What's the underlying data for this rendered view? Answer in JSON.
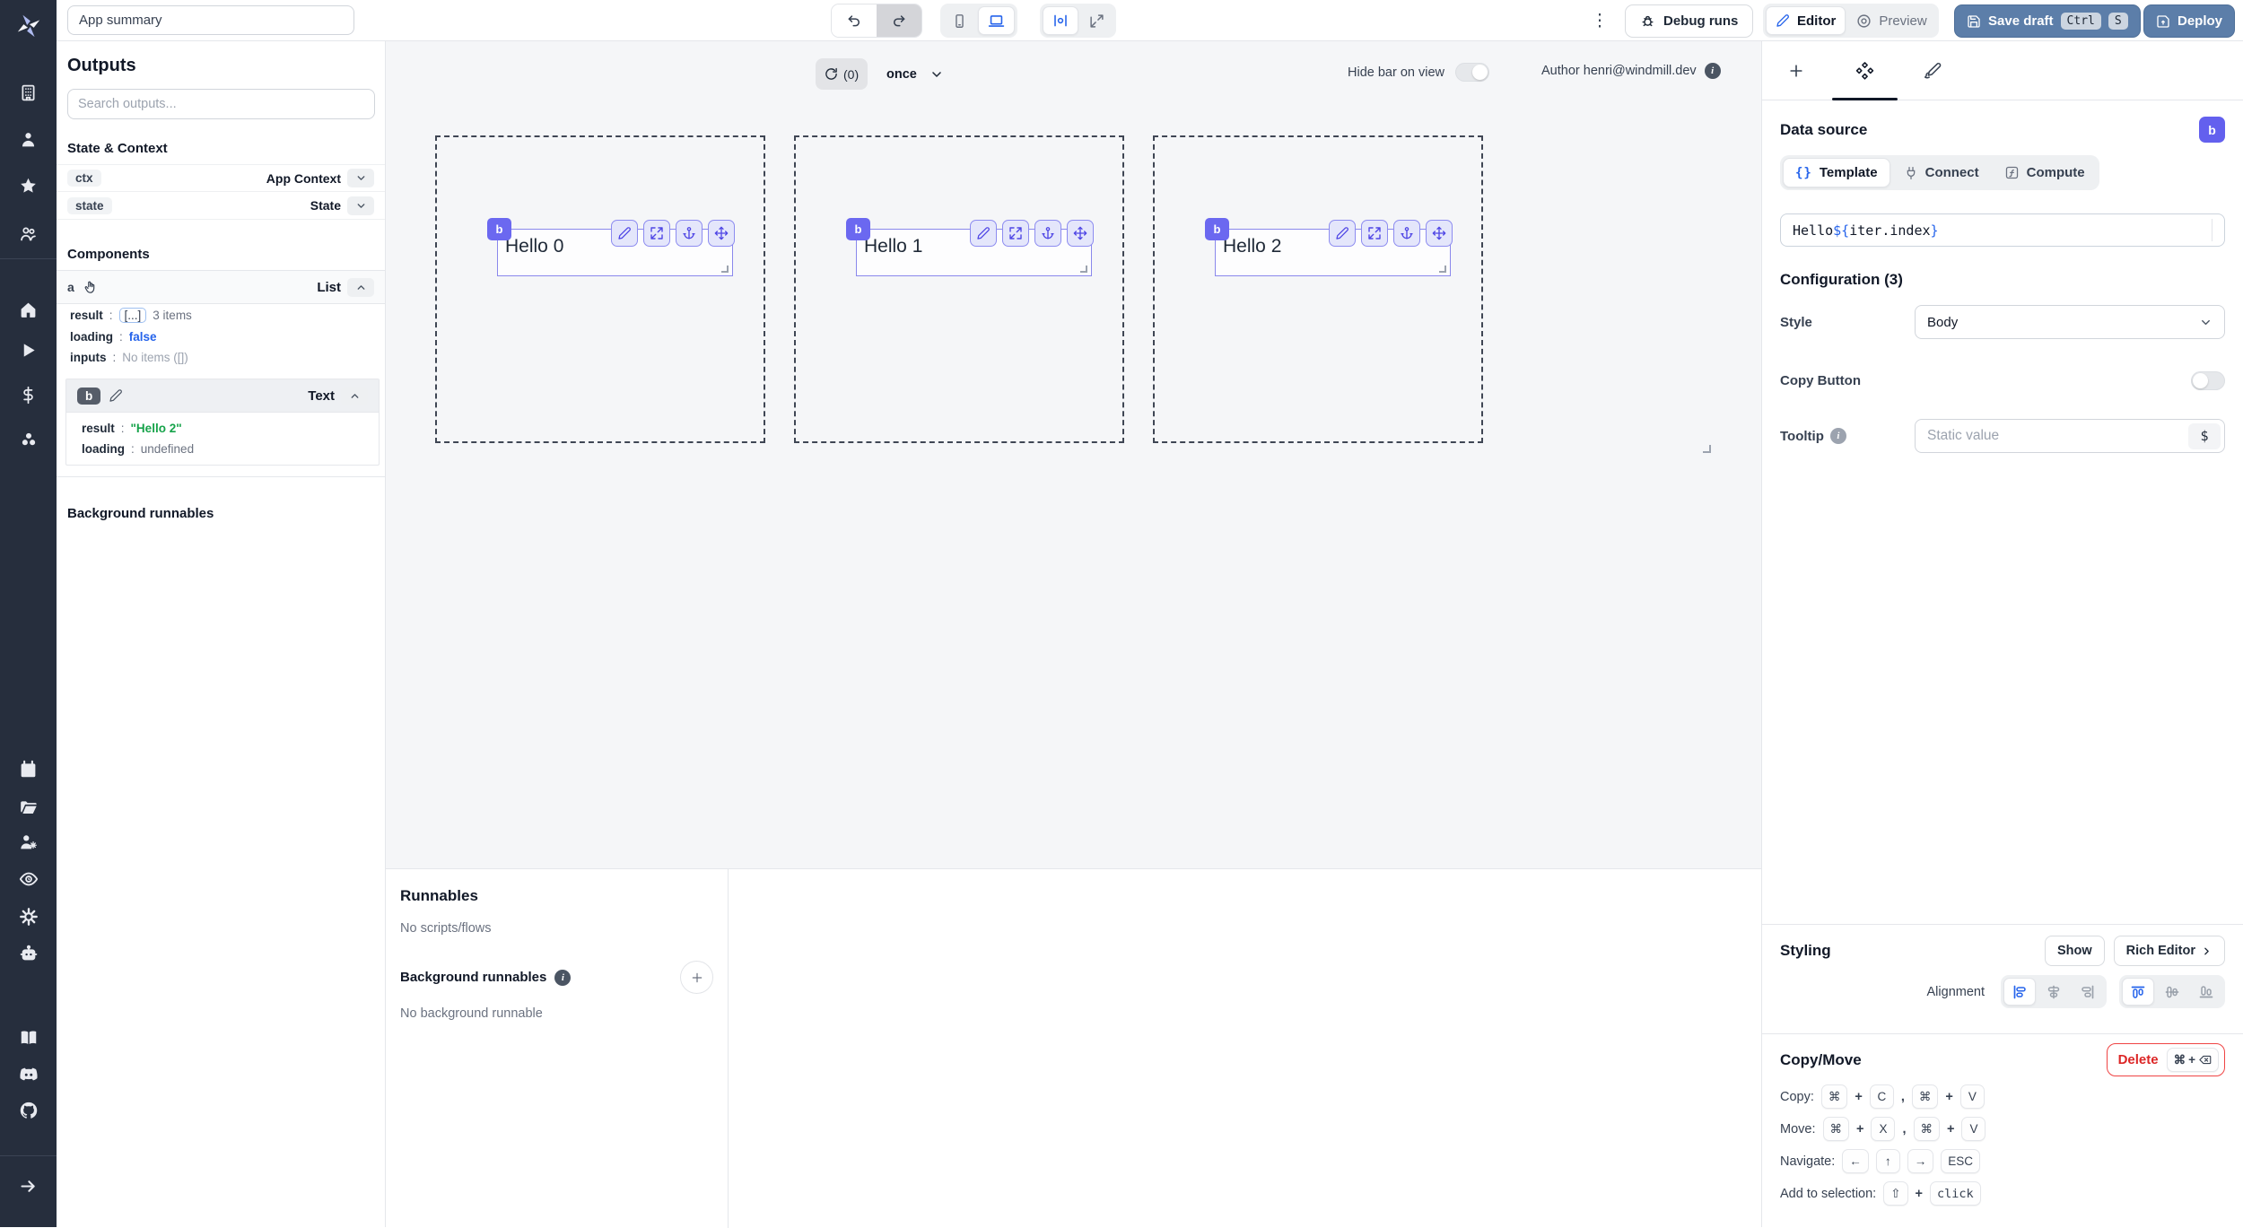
{
  "topbar": {
    "app_summary": "App summary",
    "menu_dots": "⋮",
    "debug_runs": "Debug runs",
    "editor": "Editor",
    "preview": "Preview",
    "save_draft": "Save draft",
    "save_kbd": [
      "Ctrl",
      "S"
    ],
    "deploy": "Deploy"
  },
  "iconbar_items": [
    "windmill-logo",
    "building",
    "user",
    "star",
    "users",
    "home",
    "play",
    "dollar",
    "resources",
    "calendar",
    "folder",
    "user-cog",
    "eye",
    "settings",
    "bot",
    "book",
    "discord",
    "github",
    "expand-arrow"
  ],
  "outputs": {
    "title": "Outputs",
    "search_placeholder": "Search outputs...",
    "state_context_title": "State & Context",
    "colon": ":",
    "ctx": {
      "key": "ctx",
      "type": "App Context"
    },
    "state": {
      "key": "state",
      "type": "State"
    },
    "components_title": "Components",
    "comp_a": {
      "id": "a",
      "type": "List",
      "result_key": "result",
      "result_box": "[...]",
      "result_note": "3 items",
      "loading_key": "loading",
      "loading_val": "false",
      "inputs_key": "inputs",
      "inputs_val": "No items ([])"
    },
    "comp_b": {
      "id": "b",
      "type": "Text",
      "result_key": "result",
      "result_val": "\"Hello 2\"",
      "loading_key": "loading",
      "loading_val": "undefined"
    },
    "background_title": "Background runnables"
  },
  "canvas": {
    "refresh_count": "(0)",
    "schedule": "once",
    "hide_bar_label": "Hide bar on view",
    "author": "Author henri@windmill.dev",
    "info": "i",
    "items": [
      {
        "badge": "b",
        "text": "Hello 0"
      },
      {
        "badge": "b",
        "text": "Hello 1"
      },
      {
        "badge": "b",
        "text": "Hello 2"
      }
    ]
  },
  "runnables": {
    "title": "Runnables",
    "empty_scripts": "No scripts/flows",
    "background_title": "Background runnables",
    "info": "i",
    "empty_background": "No background runnable"
  },
  "right": {
    "data_source_title": "Data source",
    "badge": "b",
    "tabs": {
      "braces": "{}",
      "template": "Template",
      "connect": "Connect",
      "compute": "Compute"
    },
    "template_parts": {
      "prefix": "Hello ",
      "open": "${",
      "expr": "iter.index",
      "close": "}"
    },
    "configuration_title": "Configuration (3)",
    "style_label": "Style",
    "style_value": "Body",
    "copy_button_label": "Copy Button",
    "tooltip_label": "Tooltip",
    "tooltip_info": "i",
    "tooltip_placeholder": "Static value",
    "connect_dollar": "$",
    "styling_title": "Styling",
    "show_button": "Show",
    "rich_editor_button": "Rich Editor",
    "rich_editor_chevron": "›",
    "alignment_label": "Alignment",
    "copymove_title": "Copy/Move",
    "delete_button": "Delete",
    "shortcuts": {
      "cmd": "⌘",
      "plus": "+",
      "comma": ",",
      "copy_label": "Copy:",
      "c": "C",
      "v": "V",
      "move_label": "Move:",
      "x": "X",
      "navigate_label": "Navigate:",
      "left": "←",
      "up": "↑",
      "right": "→",
      "esc": "ESC",
      "addsel_label": "Add to selection:",
      "shift": "⇧",
      "click": "click"
    }
  }
}
